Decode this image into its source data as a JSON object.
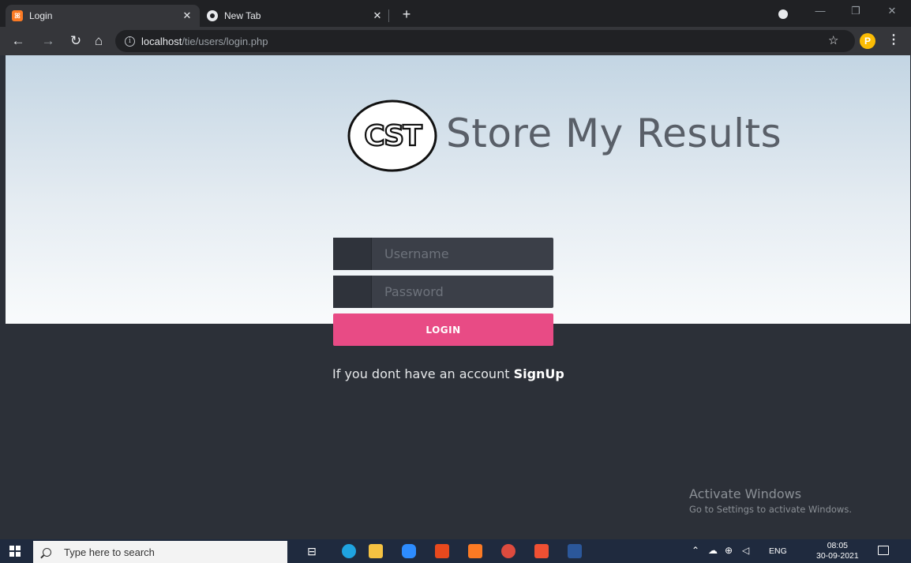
{
  "browser": {
    "tabs": [
      {
        "title": "Login",
        "active": true,
        "icon": "xampp-icon"
      },
      {
        "title": "New Tab",
        "active": false,
        "icon": "chrome-icon"
      }
    ],
    "url_host": "localhost",
    "url_path": "/tie/users/login.php",
    "profile_initial": "P"
  },
  "page": {
    "logo_text": "CST",
    "brand_title": "Store My Results",
    "username_placeholder": "Username",
    "password_placeholder": "Password",
    "login_label": "LOGIN",
    "signup_prefix": "If you dont have an account",
    "signup_link": "SignUp",
    "colors": {
      "accent": "#e84b85",
      "dark_bg": "#2c3038",
      "field_bg": "#3b3f48"
    }
  },
  "watermark": {
    "line1": "Activate Windows",
    "line2": "Go to Settings to activate Windows."
  },
  "taskbar": {
    "search_placeholder": "Type here to search",
    "language": "ENG",
    "time": "08:05",
    "date": "30-09-2021",
    "apps": [
      "task-view-icon",
      "edge-icon",
      "file-explorer-icon",
      "zoom-icon",
      "office-icon",
      "xampp-icon",
      "chrome-icon",
      "git-icon",
      "word-icon"
    ]
  }
}
